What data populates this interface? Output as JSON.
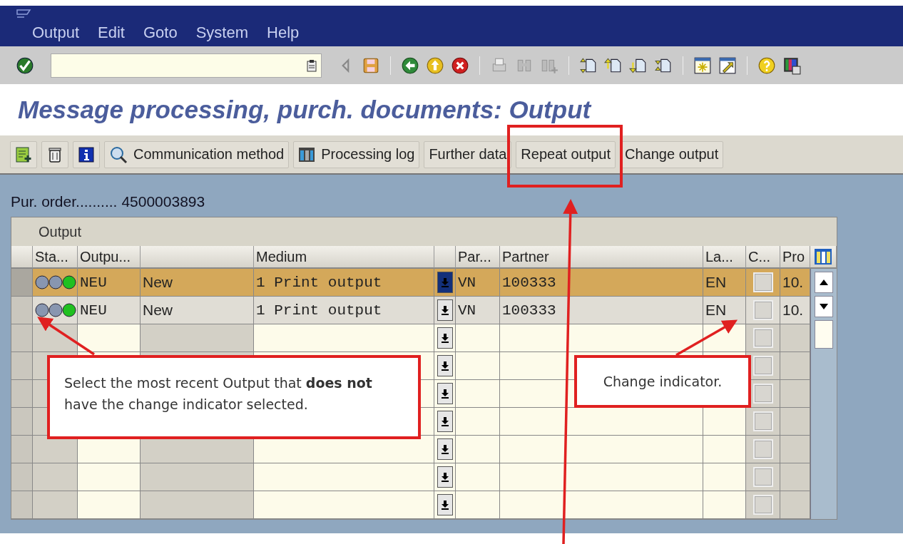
{
  "menu_bar": {
    "items": [
      "Output",
      "Edit",
      "Goto",
      "System",
      "Help"
    ]
  },
  "title": "Message processing, purch. documents: Output",
  "app_toolbar": {
    "buttons": [
      {
        "label": "Communication method"
      },
      {
        "label": "Processing log"
      },
      {
        "label": "Further data"
      },
      {
        "label": "Repeat output"
      },
      {
        "label": "Change output"
      }
    ]
  },
  "header_field": {
    "label": "Pur. order..........",
    "value": "4500003893"
  },
  "table": {
    "title": "Output",
    "columns": [
      "Sta...",
      "Outpu...",
      "Medium",
      "Par...",
      "Partner",
      "La...",
      "C...",
      "Pro"
    ],
    "rows": [
      {
        "selected": true,
        "status_lights": [
          {
            "on": false
          },
          {
            "on": false
          },
          {
            "on": true
          }
        ],
        "output_type": "NEU",
        "description": "New",
        "medium": "1 Print output",
        "function": "VN",
        "partner": "100333",
        "language": "EN",
        "changed": false,
        "processing": "10."
      },
      {
        "selected": false,
        "status_lights": [
          {
            "on": false
          },
          {
            "on": false
          },
          {
            "on": true
          }
        ],
        "output_type": "NEU",
        "description": "New",
        "medium": "1 Print output",
        "function": "VN",
        "partner": "100333",
        "language": "EN",
        "changed": false,
        "processing": "10."
      },
      {
        "selected": false,
        "changed": false
      },
      {
        "selected": false,
        "changed": false
      },
      {
        "selected": false,
        "changed": false
      },
      {
        "selected": false,
        "changed": false
      },
      {
        "selected": false,
        "changed": false
      },
      {
        "selected": false,
        "changed": false
      },
      {
        "selected": false,
        "changed": false
      }
    ]
  },
  "annotations": {
    "callouts": [
      {
        "text": "Select the most recent Output that **does not** have the change indicator selected."
      },
      {
        "text": "Change indicator."
      }
    ]
  }
}
